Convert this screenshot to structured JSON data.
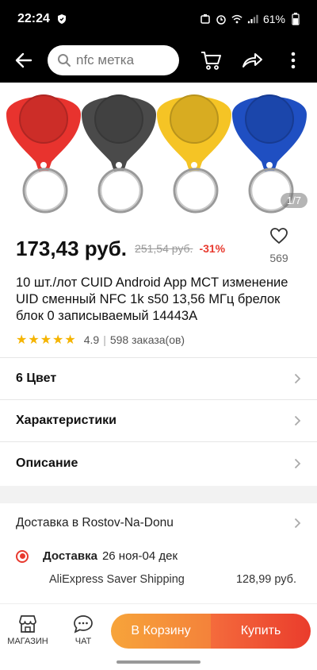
{
  "status": {
    "time": "22:24",
    "battery": "61%"
  },
  "search": {
    "placeholder": "nfc метка"
  },
  "gallery": {
    "counter": "1/7",
    "tag_colors": [
      "#e8332e",
      "#4a4a4a",
      "#f5c425",
      "#1f4fc2"
    ]
  },
  "product": {
    "price": "173,43 руб.",
    "old_price": "251,54 руб.",
    "discount": "-31%",
    "favorites": "569",
    "title": "10 шт./лот CUID Android App MCT изменение UID сменный NFC 1k s50 13,56 МГц брелок блок 0 записываемый 14443A",
    "rating": "4.9",
    "rating_stars": 5,
    "orders": "598 заказа(ов)"
  },
  "sections": {
    "color": "6 Цвет",
    "specs": "Характеристики",
    "description": "Описание"
  },
  "delivery": {
    "to": "Доставка в Rostov-Na-Donu",
    "label": "Доставка",
    "dates": "26 ноя-04 дек",
    "method": "AliExpress Saver Shipping",
    "cost": "128,99 руб."
  },
  "bottom": {
    "store": "МАГАЗИН",
    "chat": "ЧАТ",
    "add_to_cart": "В Корзину",
    "buy": "Купить"
  },
  "colors": {
    "accent_red": "#e83a2f",
    "cart_orange": "#f7a43a",
    "star": "#f5b400"
  }
}
